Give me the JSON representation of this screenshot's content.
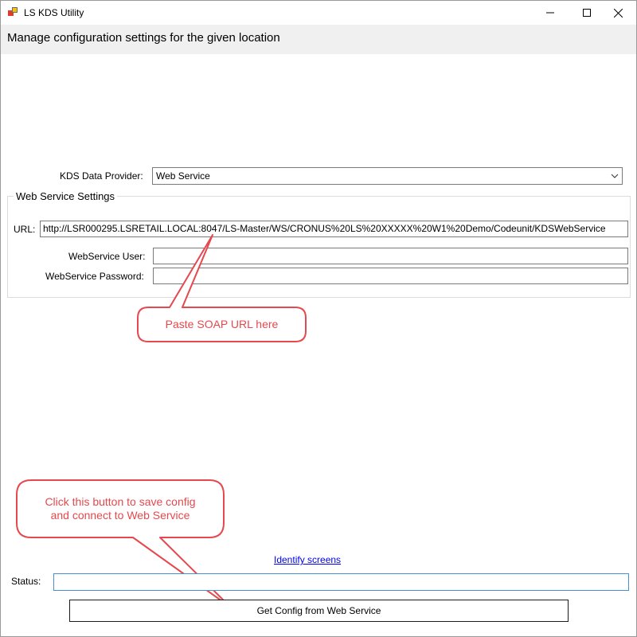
{
  "window": {
    "title": "LS KDS Utility",
    "header": "Manage configuration settings for the given location"
  },
  "provider": {
    "label": "KDS Data Provider:",
    "value": "Web Service"
  },
  "webservice": {
    "group_label": "Web Service Settings",
    "url_label": "URL:",
    "url_value": "http://LSR000295.LSRETAIL.LOCAL:8047/LS-Master/WS/CRONUS%20LS%20XXXXX%20W1%20Demo/Codeunit/KDSWebService",
    "user_label": "WebService User:",
    "user_value": "",
    "password_label": "WebService Password:",
    "password_value": ""
  },
  "callouts": {
    "url": "Paste SOAP URL here",
    "button_line1": "Click this button to save config",
    "button_line2": "and connect to Web Service"
  },
  "footer": {
    "identify_link": "Identify screens",
    "status_label": "Status:",
    "status_value": "",
    "get_config_button": "Get Config from Web Service"
  },
  "colors": {
    "callout": "#e5484d",
    "link": "#0000ee",
    "header_band": "#f0f0f0"
  }
}
